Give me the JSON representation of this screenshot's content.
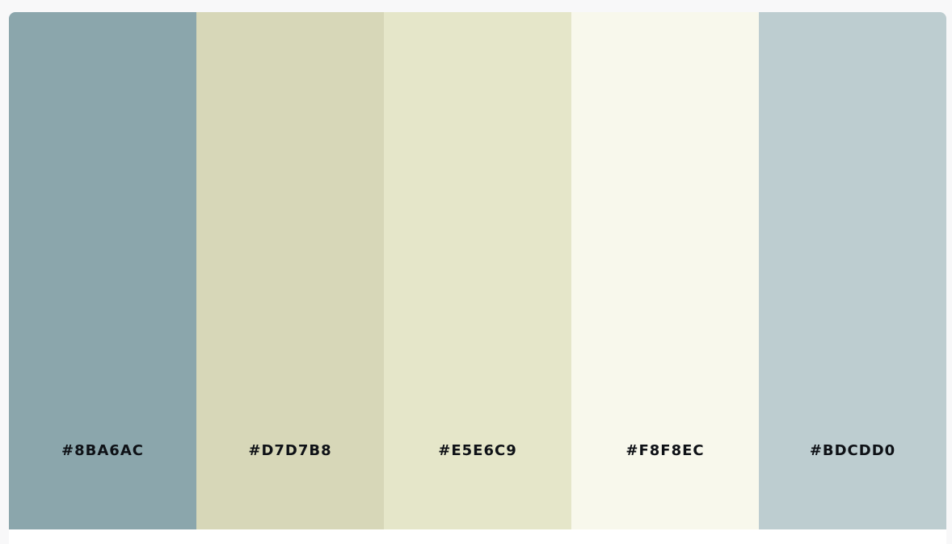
{
  "palette": {
    "swatches": [
      {
        "hex": "#8BA6AC",
        "color": "#8BA6AC"
      },
      {
        "hex": "#D7D7B8",
        "color": "#D7D7B8"
      },
      {
        "hex": "#E5E6C9",
        "color": "#E5E6C9"
      },
      {
        "hex": "#F8F8EC",
        "color": "#F8F8EC"
      },
      {
        "hex": "#BDCDD0",
        "color": "#BDCDD0"
      }
    ]
  }
}
